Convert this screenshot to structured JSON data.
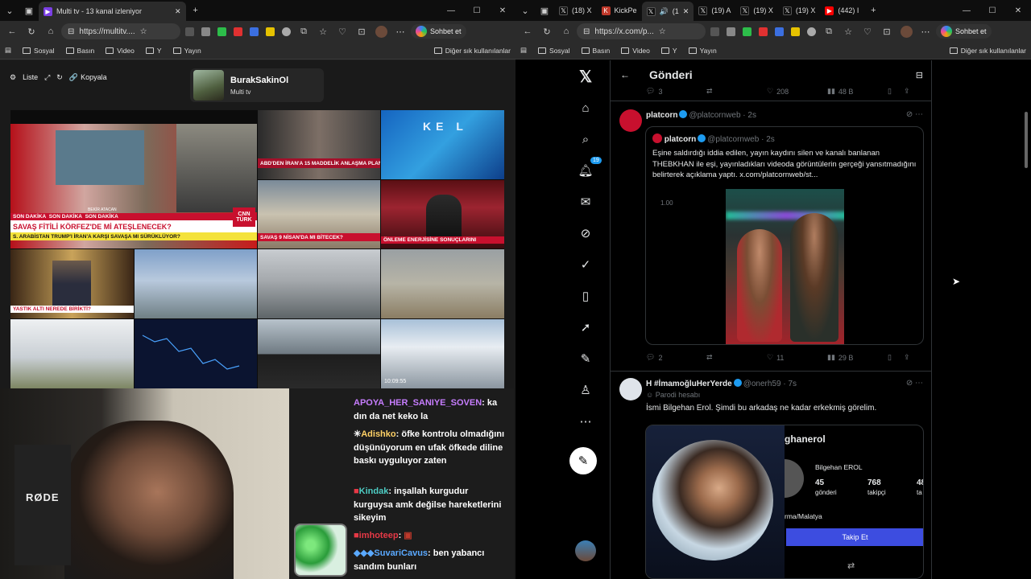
{
  "left_window": {
    "tabs": [
      {
        "title": "Multi tv - 13 kanal izleniyor",
        "favicon": "multitv-icon",
        "active": true
      }
    ],
    "address": "https://multitv....",
    "profile_button": "Sohbet et",
    "bookmarks": [
      "Sosyal",
      "Basın",
      "Video",
      "Y",
      "Yayın"
    ],
    "bookmarks_right": "Diğer sık kullanılanlar"
  },
  "multitv": {
    "toolbar": {
      "list_label": "Liste",
      "copy_label": "Kopyala"
    },
    "user": {
      "name": "BurakSakinOl",
      "subtitle": "Multi tv"
    },
    "tiles": {
      "t1": {
        "headline": "SAVAŞ FİTİLİ KÖRFEZ'DE Mİ ATEŞLENECEK?",
        "sub": "S. ARABİSTAN TRUMP'I İRAN'A KARŞI SAVAŞA MI SÜRÜKLÜYOR?",
        "ticker": "SON DAKİKA",
        "channel": "CNN TÜRK",
        "name": "BEKİR ATACAN"
      },
      "t2": {
        "headline": "ABD'DEN İRAN'A 15 MADDELİK ANLAŞMA PLANI"
      },
      "t3": {
        "logo": "KE L"
      },
      "t4": {
        "headline": "SAVAŞ 9 NİSAN'DA MI BİTECEK?",
        "tag": "SON"
      },
      "t5": {
        "headline": "ÖNLEME ENERJİSİNE SONUÇLARINI"
      },
      "t6": {
        "headline": "YASTIK ALTI NEREDE BİRİKTİ?"
      },
      "t7": {
        "time": "10:09:55"
      }
    }
  },
  "chat": {
    "messages": [
      {
        "user": "APOYA_HER_SANIYE_SOVEN",
        "color": "#c77dff",
        "text": "ka dın da net keko la"
      },
      {
        "user": "Adishko",
        "color": "#ffd166",
        "text": "öfke kontrolu olmadığını düşünüyorum en ufak öfkede diline baskı uyguluyor zaten"
      },
      {
        "user": "Kindak",
        "color": "#4ecdc4",
        "text": "inşallah kurgudur kurguysa amk değilse hareketlerini sikeyim"
      },
      {
        "user": "imhoteep",
        "color": "#e63946",
        "text": ""
      },
      {
        "user": "SuvariCavus",
        "color": "#5aa9ff",
        "text": "ben yabancı sandım bunları"
      }
    ]
  },
  "right_window": {
    "tabs": [
      {
        "title": "(18) X",
        "favicon": "x-icon"
      },
      {
        "title": "KickPe",
        "favicon": "kick-icon"
      },
      {
        "title": "(1",
        "favicon": "x-icon",
        "active": true
      },
      {
        "title": "(19) A",
        "favicon": "x-icon"
      },
      {
        "title": "(19) X",
        "favicon": "x-icon"
      },
      {
        "title": "(19) X",
        "favicon": "x-icon"
      },
      {
        "title": "(442) I",
        "favicon": "youtube-icon"
      }
    ],
    "address": "https://x.com/p...",
    "profile_button": "Sohbet et",
    "bookmarks": [
      "Sosyal",
      "Basın",
      "Video",
      "Y",
      "Yayın"
    ],
    "bookmarks_right": "Diğer sık kullanılanlar"
  },
  "x": {
    "page_title": "Gönderi",
    "notification_count": "19",
    "top_actions": {
      "replies": "3",
      "reposts": "",
      "likes": "208",
      "views": "48 B"
    },
    "tweet1": {
      "name": "platcorn",
      "handle": "@platcornweb",
      "time": "2s",
      "quote": {
        "name": "platcorn",
        "handle": "@platcornweb",
        "time": "2s",
        "text": "Eşine saldırdığı iddia edilen, yayın kaydını silen ve kanalı banlanan THEBKHAN ile eşi, yayınladıkları videoda görüntülerin gerçeği yansıtmadığını belirterek açıklama yaptı. x.com/platcornweb/st...",
        "video_time": "1.00"
      },
      "actions": {
        "replies": "2",
        "reposts": "",
        "likes": "11",
        "views": "29 B"
      }
    },
    "tweet2": {
      "name": "H #İmamoğluHerYerde",
      "handle": "@onerh59",
      "time": "7s",
      "label": "Parodi hesabı",
      "text": "İsmi Bilgehan Erol. Şimdi bu arkadaş ne kadar erkekmiş görelim.",
      "card": {
        "username": "ghanerol",
        "display_name": "Bilgehan EROL",
        "posts": "45",
        "posts_label": "gönderi",
        "followers": "768",
        "followers_label": "takipçi",
        "following": "48",
        "following_label": "ta",
        "bio": "rma/Malatya",
        "follow_button": "Takip Et"
      }
    }
  }
}
